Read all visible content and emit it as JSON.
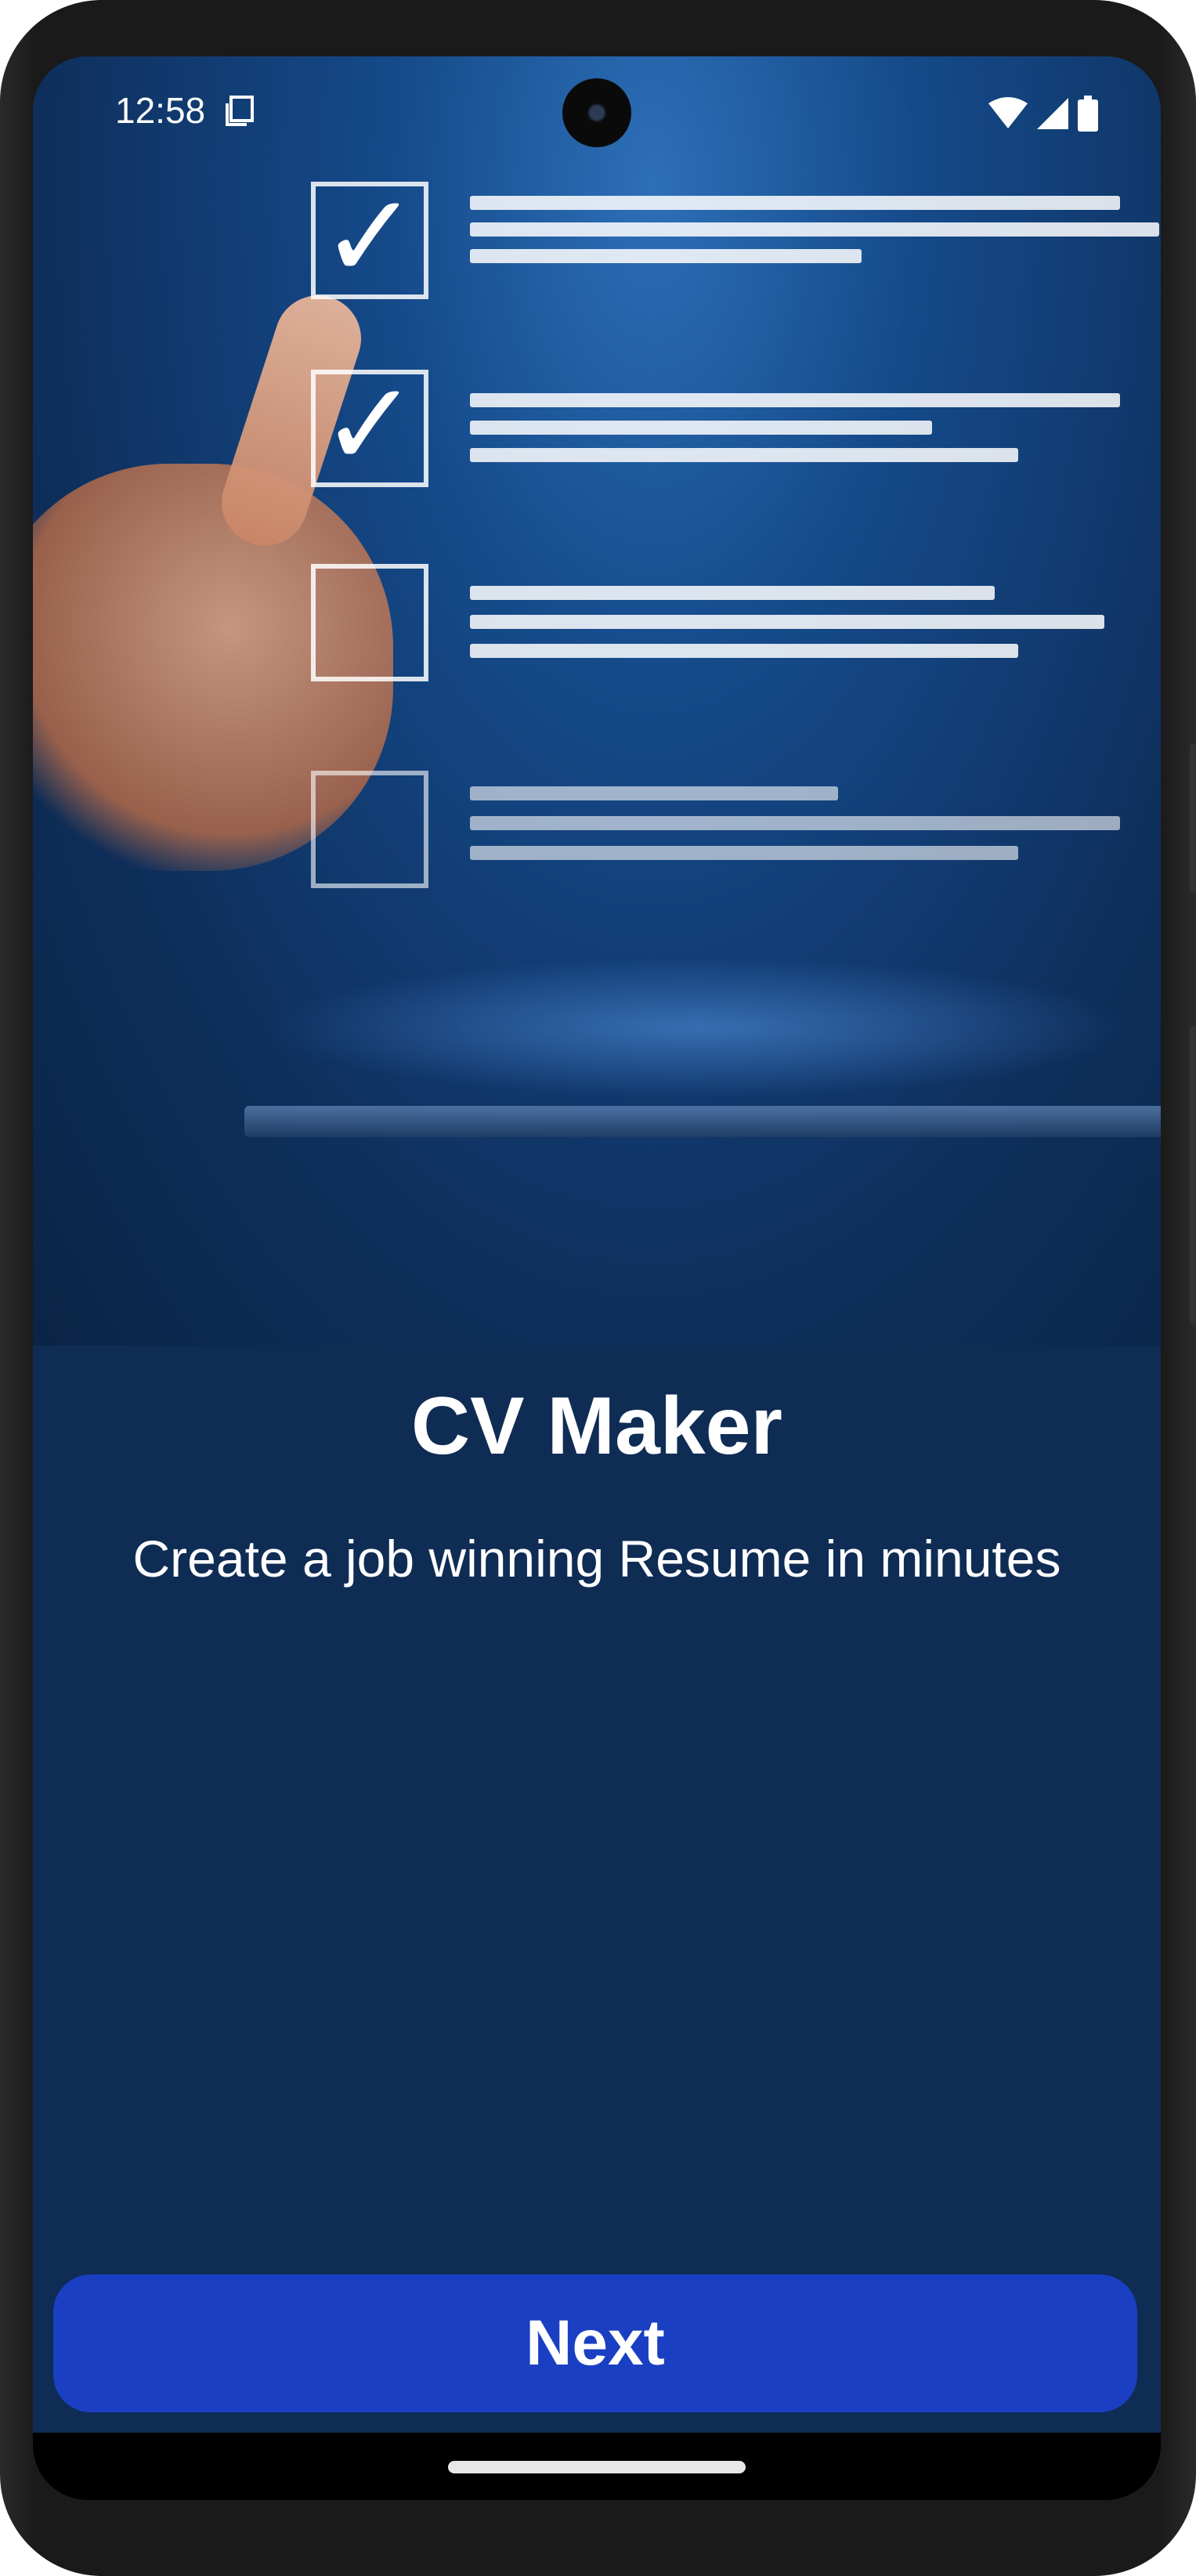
{
  "status_bar": {
    "time": "12:58",
    "icons": [
      "screenshot-doc-icon",
      "wifi-icon",
      "signal-icon",
      "battery-icon"
    ]
  },
  "hero": {
    "image": "checklist-hand-image",
    "checkmarks": [
      "✓",
      "✓",
      "",
      ""
    ]
  },
  "content": {
    "title": "CV Maker",
    "subtitle": "Create a job winning Resume in minutes"
  },
  "actions": {
    "next_label": "Next"
  },
  "colors": {
    "background": "#0f2c54",
    "button": "#1a3fc2",
    "text": "#ffffff"
  }
}
